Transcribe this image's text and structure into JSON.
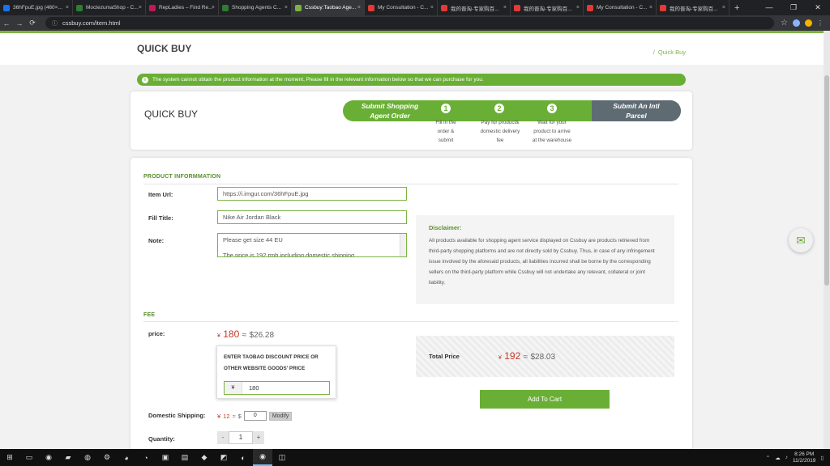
{
  "browser": {
    "tabs": [
      {
        "label": "36hFpuE.jpg (460×...",
        "color": "#1a73e8"
      },
      {
        "label": "MoctezumaShop - C...",
        "color": "#2e7d32"
      },
      {
        "label": "RepLadies – Find Re...",
        "color": "#c2185b"
      },
      {
        "label": "Shopping Agents C...",
        "color": "#2e7d32"
      },
      {
        "label": "Cssbuy:Taobao Age...",
        "color": "#7cb342",
        "active": true
      },
      {
        "label": "My Consultation - C...",
        "color": "#e53935"
      },
      {
        "label": "我的晋淘-专家购百...",
        "color": "#e53935"
      },
      {
        "label": "我的晋淘-专家购百...",
        "color": "#e53935"
      },
      {
        "label": "My Consultation - C...",
        "color": "#e53935"
      },
      {
        "label": "我的晋淘-专家购百...",
        "color": "#e53935"
      }
    ],
    "url": "cssbuy.com/item.html"
  },
  "header": {
    "title": "QUICK BUY",
    "breadcrumb_sep": "/",
    "breadcrumb": "Quick Buy"
  },
  "notice": "The system cannot obtain the product information at the moment, Please fill in the relevant information below so that we can purchase for you.",
  "steps": {
    "title": "QUICK BUY",
    "start": "Submit Shopping\nAgent Order",
    "end": "Submit An Intl\nParcel",
    "items": [
      {
        "num": "1",
        "desc": "Fill in the\norder &\nsubmit"
      },
      {
        "num": "2",
        "desc": "Pay for product&\ndomestic delivery\nfee"
      },
      {
        "num": "3",
        "desc": "Wait for your\nproduct to arrive\nat the warehouse"
      }
    ]
  },
  "product": {
    "section": "PRODUCT INFORMMATION",
    "url_label": "Item Url:",
    "url_value": "https://i.imgur.com/36hFpuE.jpg",
    "title_label": "Fill Title:",
    "title_value": "Nike Air Jordan Black",
    "note_label": "Note:",
    "note_line1": "Please get size 44 EU",
    "note_line2": "The price is 192 rmb including domestic shipping"
  },
  "disclaimer": {
    "title": "Disclaimer:",
    "text": "All products available for shopping agent service displayed on Cssbuy are products retrieved from third-party shopping platforms and are not directly sold by Cssbuy. Thus, in case of any infringement issue involved by the aforesaid products, all liabilities incurred shall be borne by the corresponding sellers on the third-party platform while Cssbuy will not undertake any relevant, collateral or joint liability."
  },
  "fee": {
    "section": "FEE",
    "price_label": "price:",
    "yen_sign": "¥",
    "price_cny": "180",
    "approx": "≈",
    "usd_sign": "$",
    "price_usd": "26.28",
    "popup_text": "ENTER TAOBAO DISCOUNT PRICE OR OTHER WEBSITE GOODS' PRICE",
    "popup_currency": "¥",
    "popup_value": "180",
    "shipping_label": "Domestic Shipping:",
    "shipping_cny": "12",
    "shipping_usd_value": "0",
    "modify": "Modify",
    "quantity_label": "Quantity:",
    "qty_minus": "-",
    "qty_value": "1",
    "qty_plus": "+"
  },
  "total": {
    "label": "Total Price",
    "cny": "192",
    "usd": "28.03"
  },
  "add_to_cart": "Add To Cart",
  "taskbar": {
    "time": "8:26 PM",
    "date": "11/2/2019"
  },
  "colors": {
    "brand_green": "#6aaf35",
    "price_red": "#c0392b"
  }
}
